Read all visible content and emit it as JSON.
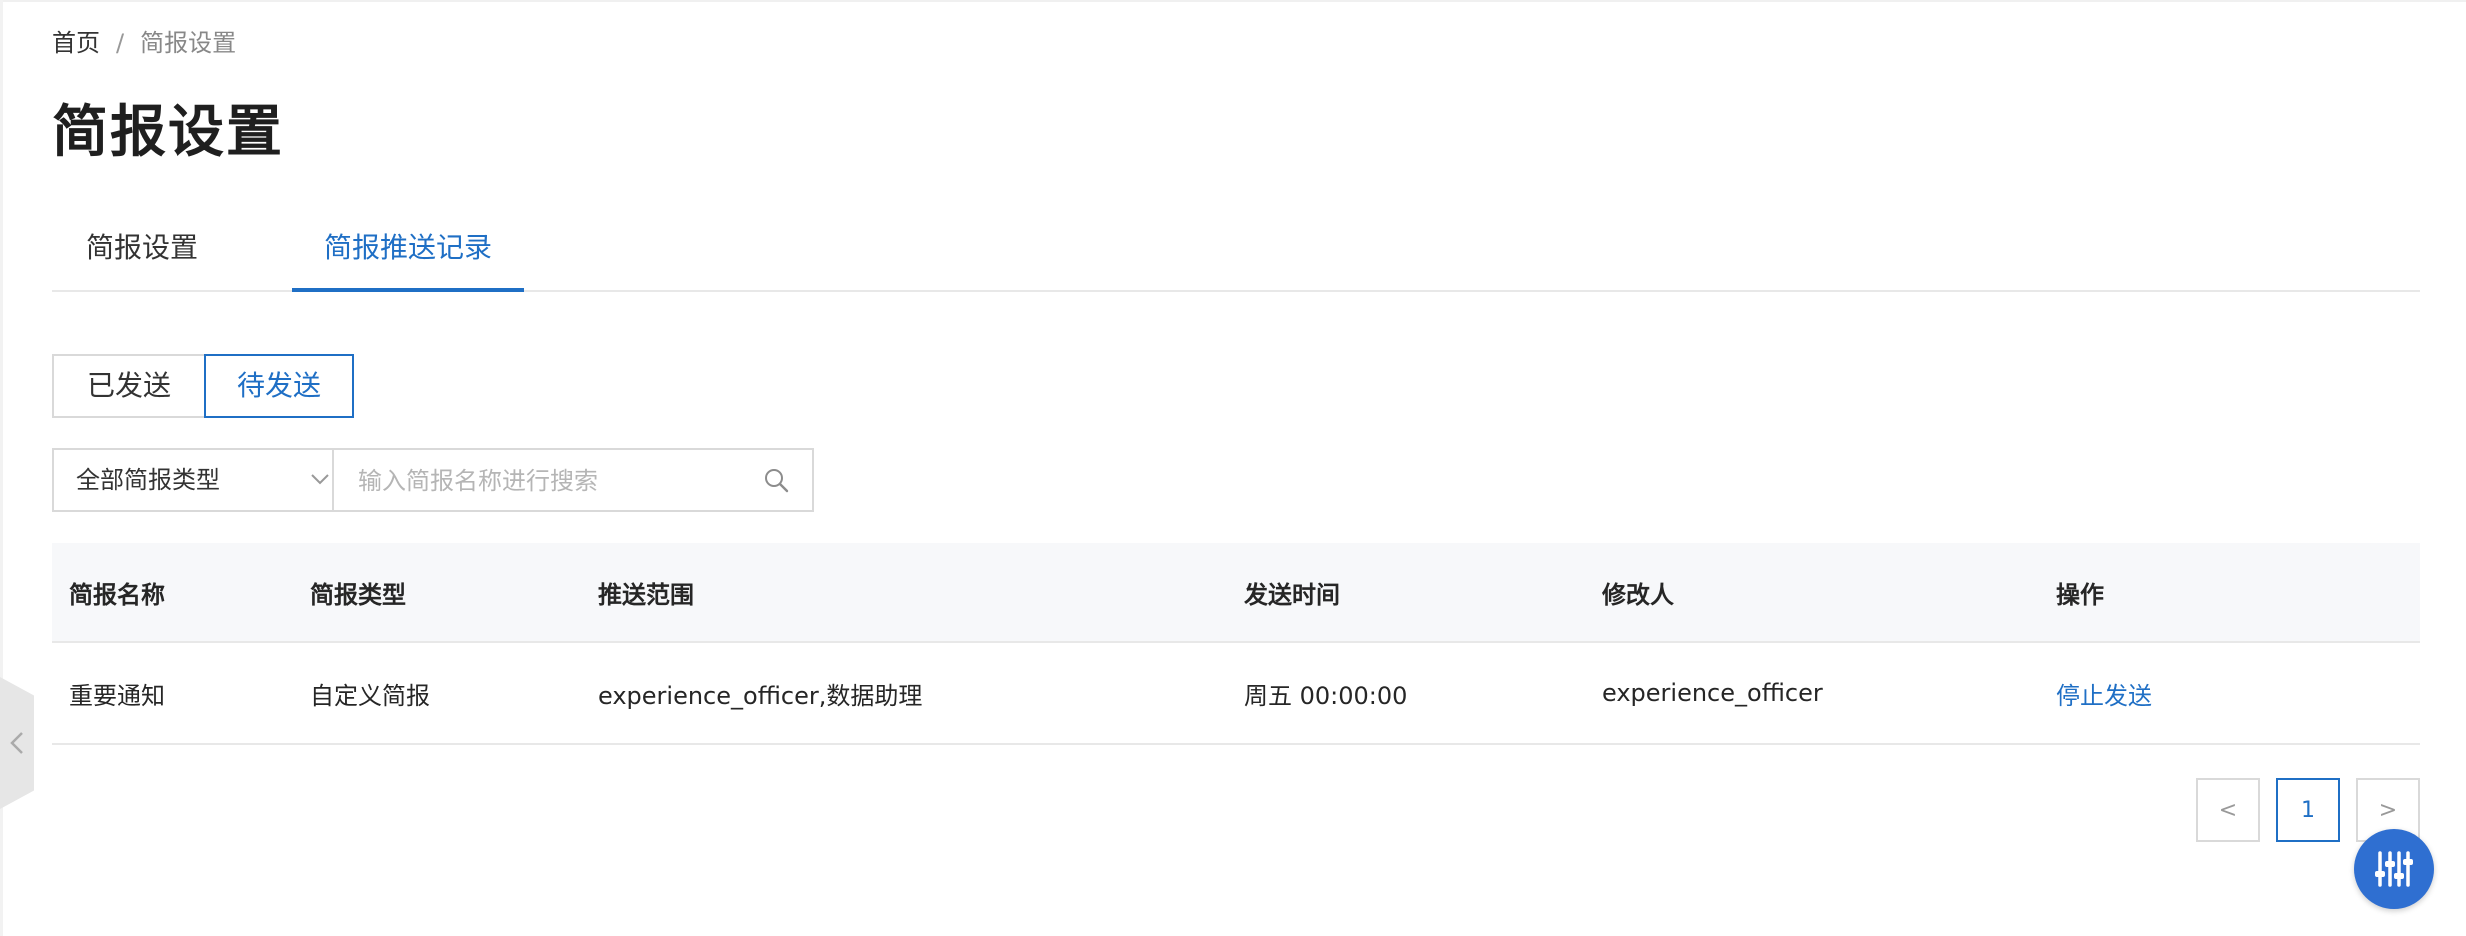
{
  "breadcrumb": {
    "home": "首页",
    "separator": "/",
    "current": "简报设置"
  },
  "page": {
    "title": "简报设置"
  },
  "tabs": [
    {
      "label": "简报设置",
      "active": false
    },
    {
      "label": "简报推送记录",
      "active": true
    }
  ],
  "status_toggle": {
    "sent": "已发送",
    "pending": "待发送",
    "selected": "待发送"
  },
  "filters": {
    "type_select": {
      "value": "全部简报类型",
      "icon": "chevron-down-icon"
    },
    "search": {
      "placeholder": "输入简报名称进行搜索",
      "value": "",
      "icon": "search-icon"
    }
  },
  "table": {
    "columns": [
      "简报名称",
      "简报类型",
      "推送范围",
      "发送时间",
      "修改人",
      "操作"
    ],
    "rows": [
      {
        "name": "重要通知",
        "type": "自定义简报",
        "scope": "experience_officer,数据助理",
        "send_time": "周五 00:00:00",
        "modifier": "experience_officer",
        "action": "停止发送"
      }
    ]
  },
  "pagination": {
    "prev": "<",
    "current_page": "1",
    "next": ">"
  },
  "colors": {
    "accent": "#1f6fc5",
    "float_button": "#2f6fd1"
  }
}
